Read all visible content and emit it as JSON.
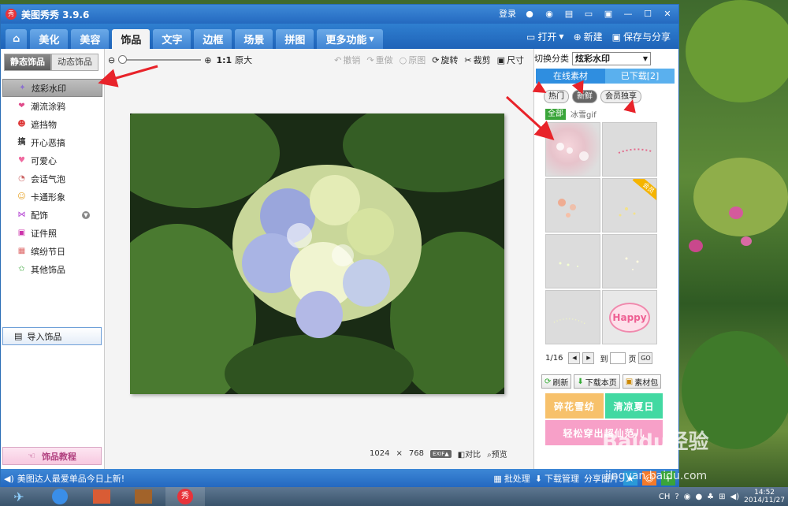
{
  "app": {
    "title": "美图秀秀 3.9.6",
    "logo_text": "秀"
  },
  "titlebar": {
    "login": "登录"
  },
  "nav": {
    "tabs": [
      "美化",
      "美容",
      "饰品",
      "文字",
      "边框",
      "场景",
      "拼图"
    ],
    "active": "饰品",
    "more": "更多功能",
    "open": "打开",
    "new": "新建",
    "save": "保存与分享"
  },
  "left": {
    "tabs": {
      "static": "静态饰品",
      "dynamic": "动态饰品"
    },
    "categories": [
      {
        "label": "炫彩水印",
        "icon": "watermark-icon"
      },
      {
        "label": "潮流涂鸦",
        "icon": "lips-icon"
      },
      {
        "label": "遮挡物",
        "icon": "mask-icon"
      },
      {
        "label": "开心恶搞",
        "icon": "funny-icon"
      },
      {
        "label": "可爱心",
        "icon": "heart-icon"
      },
      {
        "label": "会话气泡",
        "icon": "bubble-icon"
      },
      {
        "label": "卡通形象",
        "icon": "cartoon-icon"
      },
      {
        "label": "配饰",
        "icon": "bow-icon"
      },
      {
        "label": "证件照",
        "icon": "id-photo-icon"
      },
      {
        "label": "缤纷节日",
        "icon": "gift-icon"
      },
      {
        "label": "其他饰品",
        "icon": "star-icon"
      }
    ],
    "import": "导入饰品",
    "tutorial": "饰品教程"
  },
  "toolbar": {
    "zoom_ratio": "1:1",
    "zoom_original": "原大",
    "undo": "撤销",
    "redo": "重做",
    "original": "原图",
    "rotate": "旋转",
    "crop": "裁剪",
    "size": "尺寸"
  },
  "image_info": {
    "width": "1024",
    "times": "×",
    "height": "768",
    "exif": "EXIF▲",
    "compare": "对比",
    "preview": "预览"
  },
  "right": {
    "switch_label": "切换分类",
    "switch_value": "炫彩水印",
    "tab_online": "在线素材",
    "tab_downloaded": "已下载[2]",
    "chips": [
      "热门",
      "新鲜",
      "会员独享"
    ],
    "chip_active": "新鲜",
    "filter_all": "全部",
    "filter_item": "冰雪gif",
    "vip_badge": "会员",
    "happy_text": "Happy",
    "pager": {
      "page": "1/16",
      "to": "到",
      "unit": "页",
      "go": "GO"
    },
    "actions": {
      "refresh": "刷新",
      "download": "下载本页",
      "pack": "素材包"
    },
    "promos": [
      "碎花雪纺",
      "清凉夏日",
      "轻松穿出超仙范儿"
    ]
  },
  "bottombar": {
    "notice": "美图达人最爱单品今日上新!",
    "batch": "批处理",
    "download": "下载管理",
    "share": "分享图片"
  },
  "taskbar": {
    "lang": "CH",
    "time": "14:52",
    "date": "2014/11/27"
  },
  "watermark": {
    "brand": "Baidu经验",
    "url": "jingyan.baidu.com"
  }
}
